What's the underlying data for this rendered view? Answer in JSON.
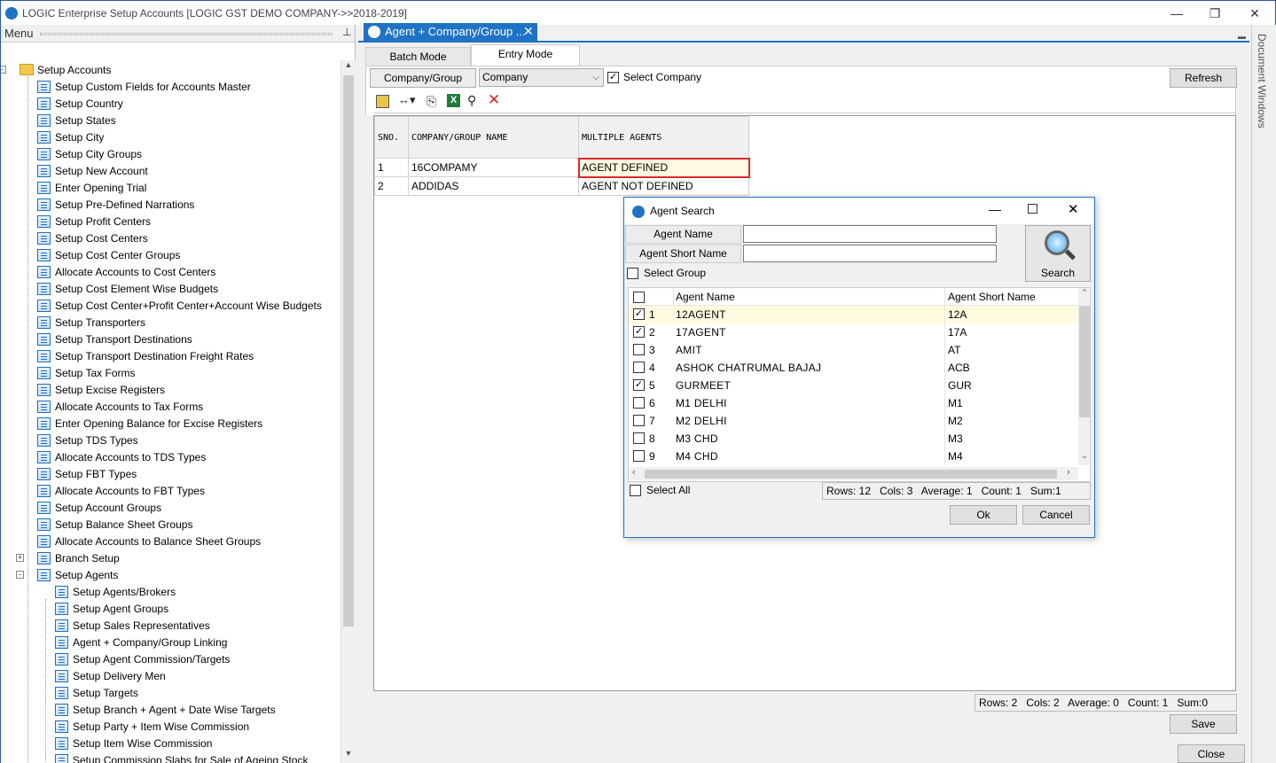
{
  "window": {
    "title": "LOGIC Enterprise Setup Accounts  [LOGIC GST DEMO COMPANY->>2018-2019]",
    "controls": [
      "—",
      "❐",
      "✕"
    ]
  },
  "menu": {
    "label": "Menu",
    "pin": "⊥",
    "root": "Setup Accounts",
    "items": [
      "Setup Custom Fields for Accounts Master",
      "Setup Country",
      "Setup States",
      "Setup City",
      "Setup City Groups",
      "Setup New Account",
      "Enter Opening Trial",
      "Setup Pre-Defined Narrations",
      "Setup Profit Centers",
      "Setup Cost Centers",
      "Setup Cost Center Groups",
      "Allocate Accounts to Cost Centers",
      "Setup Cost Element Wise Budgets",
      "Setup Cost Center+Profit Center+Account Wise Budgets",
      "Setup Transporters",
      "Setup Transport Destinations",
      "Setup Transport Destination Freight Rates",
      "Setup Tax Forms",
      "Setup Excise Registers",
      "Allocate Accounts to Tax Forms",
      "Enter Opening Balance for Excise Registers",
      "Setup TDS Types",
      "Allocate Accounts to TDS Types",
      "Setup FBT Types",
      "Allocate Accounts to FBT Types",
      "Setup Account Groups",
      "Setup Balance Sheet Groups",
      "Allocate Accounts to Balance Sheet Groups"
    ],
    "branch": "Branch Setup",
    "agents_group": "Setup Agents",
    "agent_items": [
      "Setup Agents/Brokers",
      "Setup Agent Groups",
      "Setup Sales Representatives",
      "Agent + Company/Group Linking",
      "Setup Agent Commission/Targets",
      "Setup Delivery Men",
      "Setup Targets",
      "Setup Branch + Agent + Date Wise Targets",
      "Setup Party + Item Wise Commission",
      "Setup Item Wise Commission",
      "Setup Commission Slabs for Sale of Ageing Stock"
    ]
  },
  "doc_windows_label": "Document Windows",
  "doc_tab": {
    "label": "Agent + Company/Group ...",
    "close": "✕"
  },
  "modes": {
    "batch": "Batch Mode",
    "entry": "Entry Mode"
  },
  "filter": {
    "company_group_label": "Company/Group",
    "company_value": "Company",
    "select_company_label": "Select Company",
    "refresh": "Refresh"
  },
  "grid": {
    "headers": [
      "SNO.",
      "COMPANY/GROUP NAME",
      "MULTIPLE AGENTS"
    ],
    "rows": [
      {
        "sno": "1",
        "name": "16COMPAMY",
        "agents": "AGENT DEFINED"
      },
      {
        "sno": "2",
        "name": "ADDIDAS",
        "agents": "AGENT NOT DEFINED"
      }
    ],
    "status": {
      "rows": "Rows: 2",
      "cols": "Cols: 2",
      "average": "Average: 0",
      "count": "Count: 1",
      "sum": "Sum:0"
    },
    "save": "Save",
    "close": "Close"
  },
  "dialog": {
    "title": "Agent Search",
    "agent_name_label": "Agent Name",
    "agent_short_name_label": "Agent Short Name",
    "select_group_label": "Select Group",
    "search_label": "Search",
    "col_agent_name": "Agent Name",
    "col_short_name": "Agent Short Name",
    "agents": [
      {
        "n": "1",
        "name": "12AGENT",
        "short": "12A",
        "checked": true
      },
      {
        "n": "2",
        "name": "17AGENT",
        "short": "17A",
        "checked": true
      },
      {
        "n": "3",
        "name": "AMIT",
        "short": "AT",
        "checked": false
      },
      {
        "n": "4",
        "name": "ASHOK CHATRUMAL BAJAJ",
        "short": "ACB",
        "checked": false
      },
      {
        "n": "5",
        "name": "GURMEET",
        "short": "GUR",
        "checked": true
      },
      {
        "n": "6",
        "name": "M1 DELHI",
        "short": "M1",
        "checked": false
      },
      {
        "n": "7",
        "name": "M2 DELHI",
        "short": "M2",
        "checked": false
      },
      {
        "n": "8",
        "name": "M3 CHD",
        "short": "M3",
        "checked": false
      },
      {
        "n": "9",
        "name": "M4 CHD",
        "short": "M4",
        "checked": false
      }
    ],
    "select_all_label": "Select All",
    "status": {
      "rows": "Rows: 12",
      "cols": "Cols: 3",
      "average": "Average: 1",
      "count": "Count: 1",
      "sum": "Sum:1"
    },
    "ok": "Ok",
    "cancel": "Cancel"
  },
  "colors": {
    "accent": "#1f73c4",
    "selected_row": "#fffbe0",
    "highlight_border": "#d9272e"
  }
}
